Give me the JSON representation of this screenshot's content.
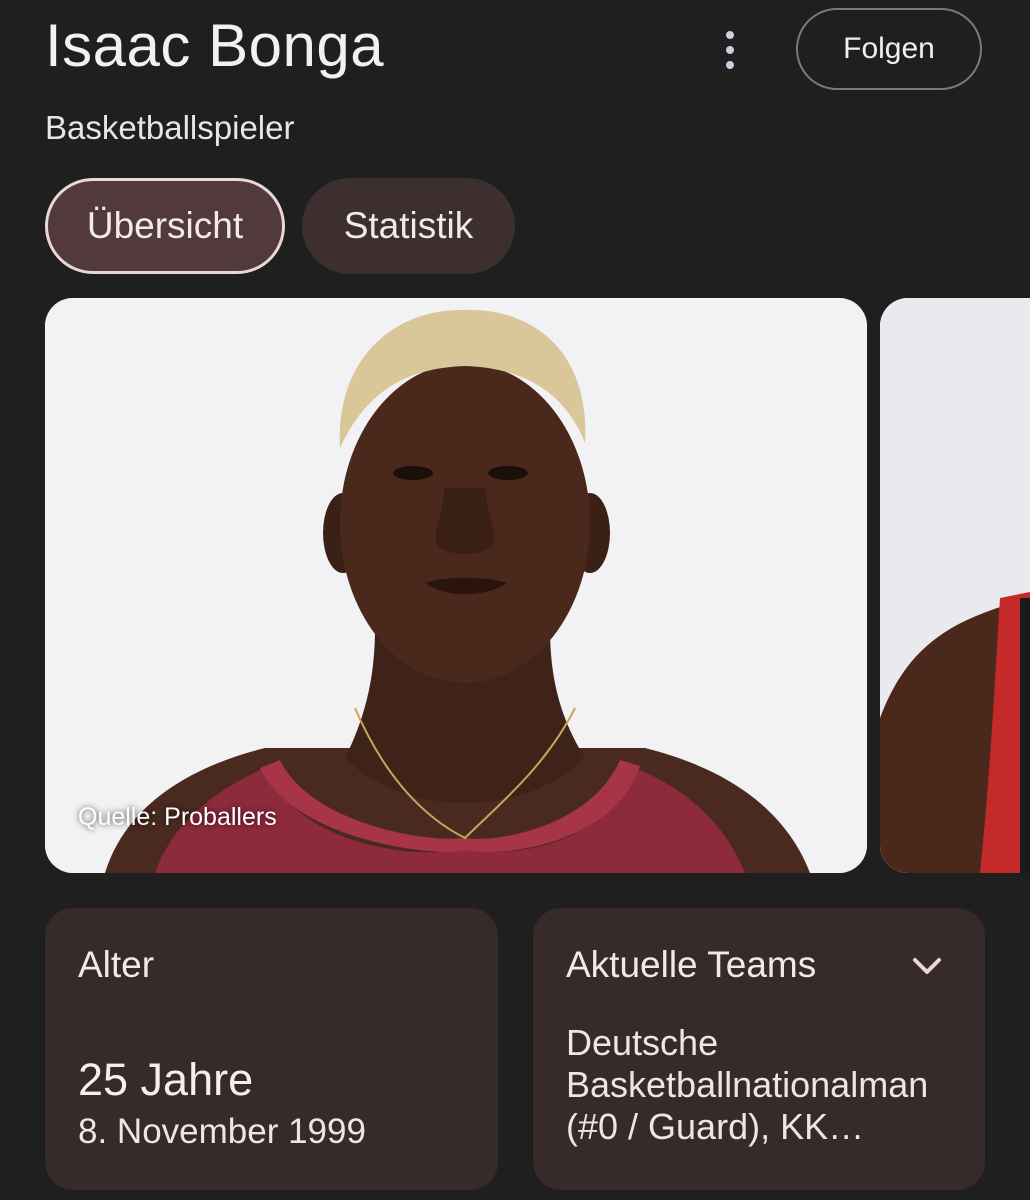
{
  "header": {
    "title": "Isaac Bonga",
    "subtitle": "Basketballspieler",
    "follow_label": "Folgen"
  },
  "tabs": [
    {
      "label": "Übersicht",
      "active": true
    },
    {
      "label": "Statistik",
      "active": false
    }
  ],
  "images": {
    "caption": "Quelle: Proballers"
  },
  "age_card": {
    "label": "Alter",
    "value": "25 Jahre",
    "date": "8. November 1999"
  },
  "teams_card": {
    "label": "Aktuelle Teams",
    "text": "Deutsche\nBasketballnationalman\n(#0 / Guard), KK…"
  },
  "colors": {
    "background": "#1f1f1f",
    "tab_active": "#523a3c",
    "tab_inactive": "#3d2f30",
    "card": "#362a2b",
    "jersey": "#8d2a3c"
  },
  "icons": {
    "more": "more-vertical-icon",
    "expand": "chevron-down-icon"
  }
}
